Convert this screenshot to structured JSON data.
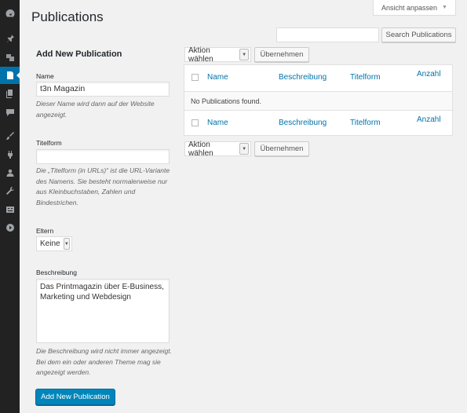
{
  "admin_menu": [
    {
      "icon": "dashboard-icon"
    },
    {
      "icon": "pin-icon"
    },
    {
      "icon": "media-icon"
    },
    {
      "icon": "page-icon",
      "active": true
    },
    {
      "icon": "pages-icon"
    },
    {
      "icon": "comments-icon"
    },
    {
      "icon": "appearance-icon"
    },
    {
      "icon": "plugins-icon"
    },
    {
      "icon": "users-icon"
    },
    {
      "icon": "tools-icon"
    },
    {
      "icon": "settings-icon"
    },
    {
      "icon": "play-icon"
    }
  ],
  "header": {
    "title": "Publications",
    "screen_options": "Ansicht anpassen"
  },
  "search": {
    "placeholder": "",
    "button": "Search Publications"
  },
  "form": {
    "title": "Add New Publication",
    "name_label": "Name",
    "name_value": "t3n Magazin",
    "name_desc": "Dieser Name wird dann auf der Website angezeigt.",
    "slug_label": "Titelform",
    "slug_value": "",
    "slug_desc": "Die „Titelform (in URLs)“ ist die URL-Variante des Namens. Sie besteht normalerweise nur aus Kleinbuchstaben, Zahlen und Bindestrichen.",
    "parent_label": "Eltern",
    "parent_value": "Keine",
    "description_label": "Beschreibung",
    "description_value": "Das Printmagazin über E-Business,\nMarketing und Webdesign",
    "description_desc": "Die Beschreibung wird nicht immer angezeigt. Bei dem ein oder anderen Theme mag sie angezeigt werden.",
    "submit": "Add New Publication"
  },
  "list": {
    "bulk_action": "Aktion wählen",
    "apply": "Übernehmen",
    "columns": {
      "name": "Name",
      "description": "Beschreibung",
      "slug": "Titelform",
      "count": "Anzahl"
    },
    "empty_message": "No Publications found."
  }
}
